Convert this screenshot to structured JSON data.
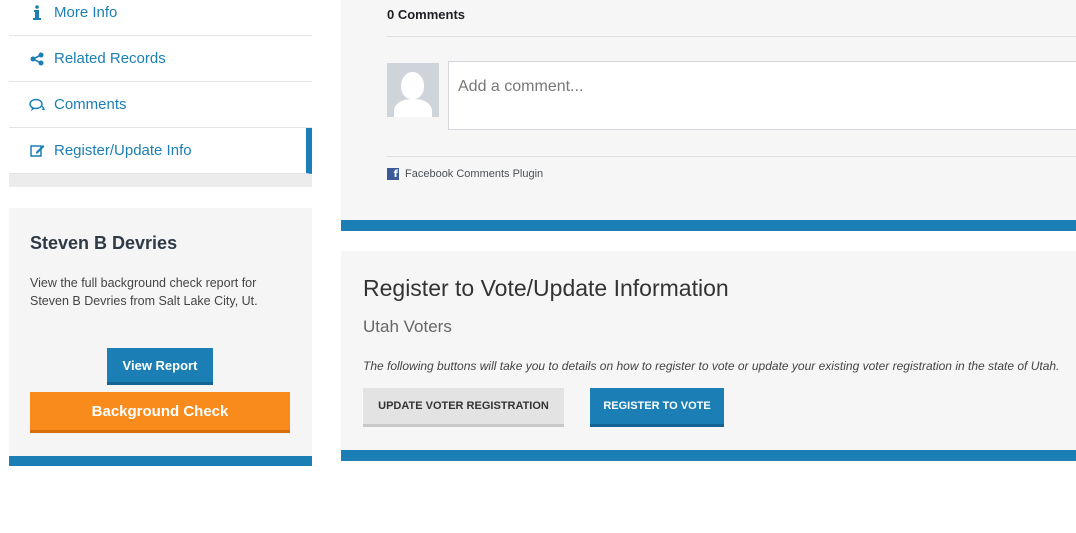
{
  "sidebar": {
    "items": [
      {
        "label": "More Info",
        "icon": "info-icon"
      },
      {
        "label": "Related Records",
        "icon": "share-icon"
      },
      {
        "label": "Comments",
        "icon": "comments-icon"
      },
      {
        "label": "Register/Update Info",
        "icon": "edit-icon",
        "active": true
      }
    ]
  },
  "profile": {
    "name": "Steven B Devries",
    "description": "View the full background check report for Steven B Devries from Salt Lake City, Ut.",
    "view_report_label": "View Report",
    "background_check_label": "Background Check"
  },
  "comments": {
    "count_label": "0 Comments",
    "placeholder": "Add a comment...",
    "plugin_label": "Facebook Comments Plugin"
  },
  "register": {
    "title": "Register to Vote/Update Information",
    "subtitle": "Utah Voters",
    "description": "The following buttons will take you to details on how to register to vote or update your existing voter registration in the state of Utah.",
    "update_label": "UPDATE VOTER REGISTRATION",
    "register_label": "REGISTER TO VOTE"
  },
  "colors": {
    "accent": "#1b7fb5",
    "orange": "#f98a1c",
    "facebook": "#3b5998"
  }
}
